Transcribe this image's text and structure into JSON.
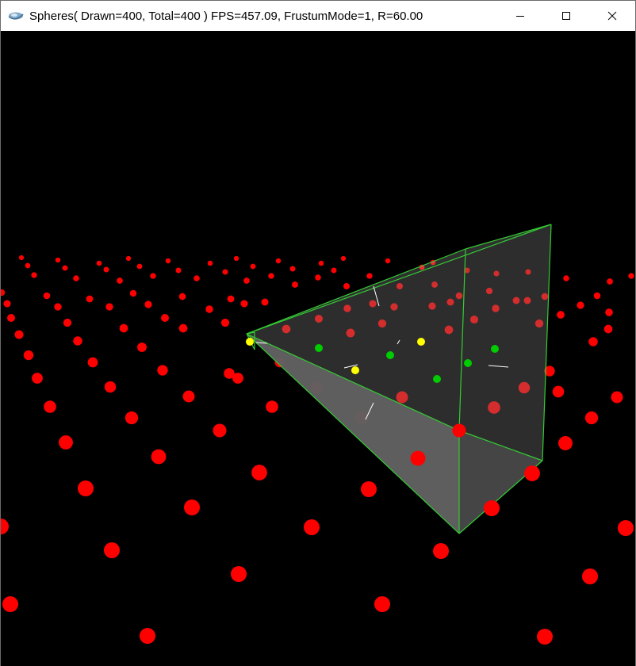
{
  "window": {
    "title": "Spheres( Drawn=400, Total=400 ) FPS=457.09, FrustumMode=1, R=60.00",
    "app_icon": "opengl-app-icon",
    "buttons": {
      "minimize": "minimize-icon",
      "maximize": "maximize-icon",
      "close": "close-icon"
    }
  },
  "scene": {
    "background": "#000000",
    "sphere_count_drawn": 400,
    "sphere_count_total": 400,
    "colors": {
      "outside_frustum": "#ff0000",
      "inside_frustum": "#00cc00",
      "intersecting_frustum": "#ffff00",
      "frustum_edges": "#33cc33",
      "frustum_faces": "#808080"
    }
  }
}
